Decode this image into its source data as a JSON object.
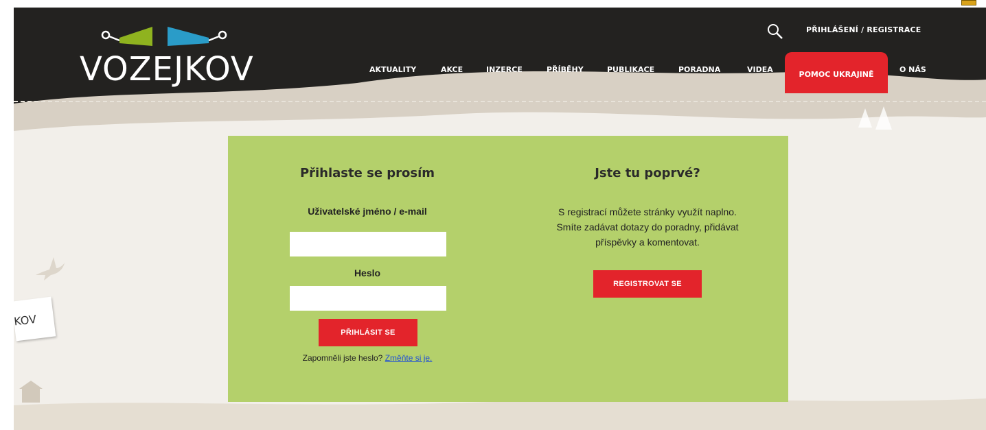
{
  "header": {
    "logo": "VOZEJKOV",
    "logo_icon": "two-cart-wheels-logo",
    "search_icon": "search-icon",
    "top_login": "PŘIHLÁŠENÍ / REGISTRACE"
  },
  "nav": {
    "items": [
      {
        "label": "AKTUALITY"
      },
      {
        "label": "AKCE"
      },
      {
        "label": "INZERCE"
      },
      {
        "label": "PŘÍBĚHY"
      },
      {
        "label": "PUBLIKACE"
      },
      {
        "label": "PORADNA"
      },
      {
        "label": "VIDEA"
      },
      {
        "label": "POMOC UKRAJINĚ"
      },
      {
        "label": "O NÁS"
      }
    ],
    "highlight_color": "#e3242b"
  },
  "login": {
    "title": "Přihlaste se prosím",
    "username_label": "Uživatelské jméno / e-mail",
    "username_value": "",
    "password_label": "Heslo",
    "password_value": "",
    "submit_label": "PŘIHLÁSIT SE",
    "forgot_text": "Zapomněli jste heslo?",
    "forgot_link": "Změňte si je."
  },
  "register": {
    "title": "Jste tu poprvé?",
    "lines": [
      "S registrací můžete stránky využít naplno.",
      "Smíte zadávat dotazy do poradny, přidávat",
      "příspěvky a komentovat."
    ],
    "button_label": "REGISTROVAT SE"
  },
  "decor": {
    "sign_text": "KOV",
    "panel_color": "#b4d06b",
    "header_color": "#232220"
  }
}
